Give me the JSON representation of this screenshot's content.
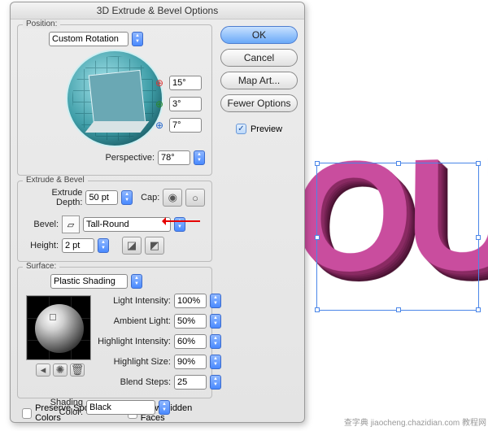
{
  "dialog": {
    "title": "3D Extrude & Bevel Options",
    "buttons": {
      "ok": "OK",
      "cancel": "Cancel",
      "map_art": "Map Art...",
      "fewer_options": "Fewer Options"
    },
    "preview": {
      "label": "Preview",
      "checked": true
    }
  },
  "position": {
    "legend": "Position:",
    "rotation_preset": "Custom Rotation",
    "x_axis": "15°",
    "y_axis": "3°",
    "z_axis": "7°",
    "perspective_label": "Perspective:",
    "perspective": "78°"
  },
  "extrude": {
    "legend": "Extrude & Bevel",
    "depth_label": "Extrude Depth:",
    "depth": "50 pt",
    "cap_label": "Cap:",
    "bevel_label": "Bevel:",
    "bevel_name": "Tall-Round",
    "height_label": "Height:",
    "height": "2 pt"
  },
  "surface": {
    "legend": "Surface:",
    "preset": "Plastic Shading",
    "light_intensity_label": "Light Intensity:",
    "light_intensity": "100%",
    "ambient_label": "Ambient Light:",
    "ambient": "50%",
    "highlight_intensity_label": "Highlight Intensity:",
    "highlight_intensity": "60%",
    "highlight_size_label": "Highlight Size:",
    "highlight_size": "90%",
    "blend_steps_label": "Blend Steps:",
    "blend_steps": "25",
    "shading_color_label": "Shading Color:",
    "shading_color": "Black",
    "preserve_spot_label": "Preserve Spot Colors",
    "draw_hidden_label": "Draw Hidden Faces"
  },
  "artboard": {
    "text": "OUT"
  },
  "watermark": "查字典 jiaocheng.chazidian.com 教程网"
}
